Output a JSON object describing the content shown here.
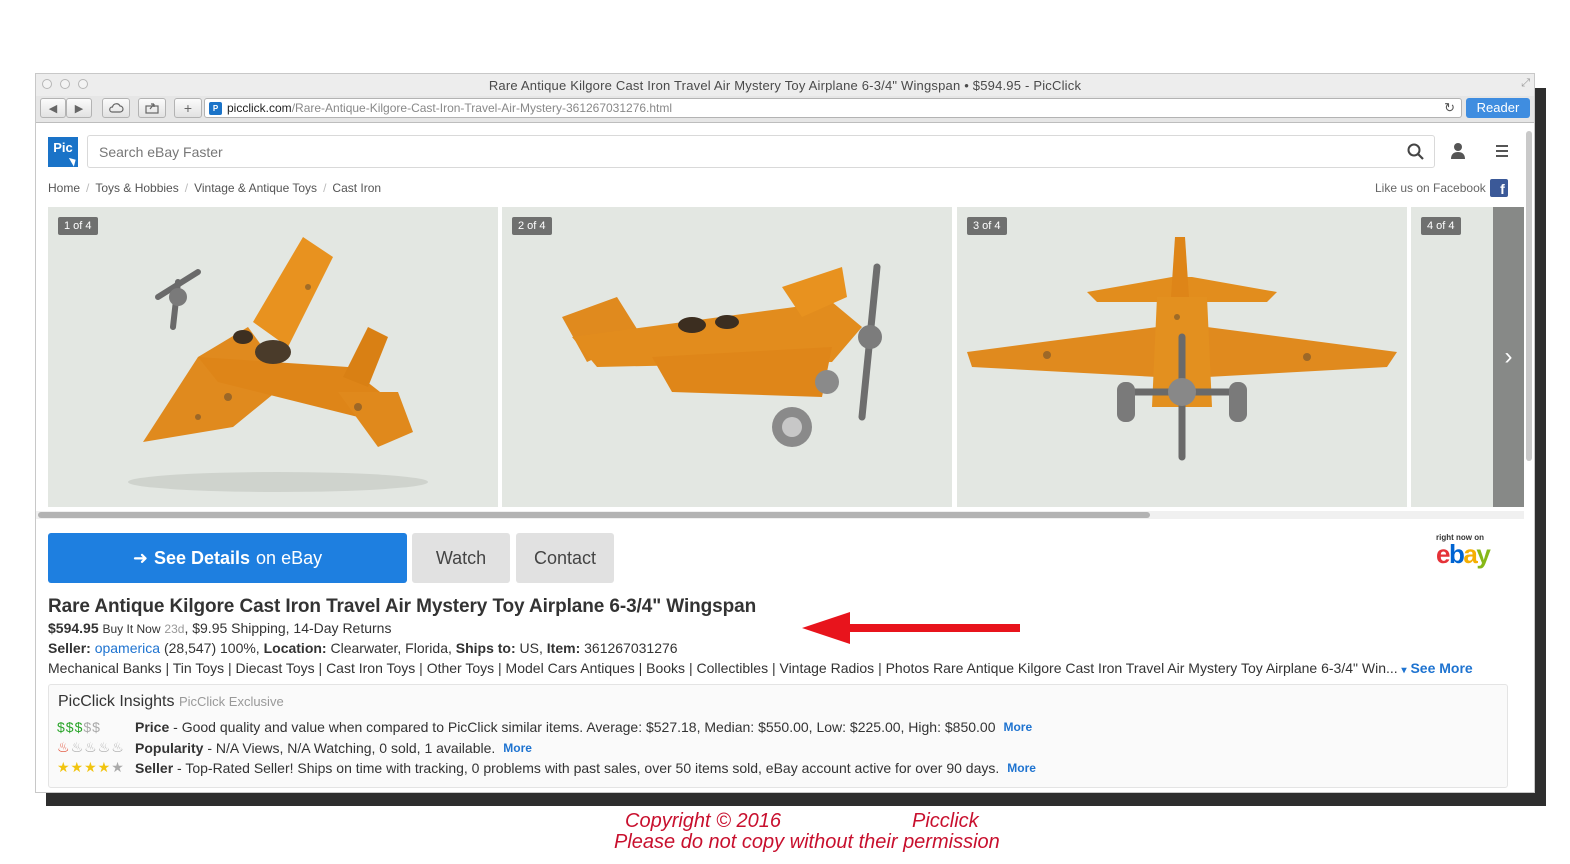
{
  "window": {
    "title": "Rare Antique Kilgore Cast Iron Travel Air Mystery Toy Airplane 6-3/4\" Wingspan • $594.95 - PicClick",
    "url_host": "picclick.com",
    "url_path": "/Rare-Antique-Kilgore-Cast-Iron-Travel-Air-Mystery-361267031276.html",
    "reader_label": "Reader"
  },
  "header": {
    "logo_text": "Pic",
    "search_placeholder": "Search eBay Faster"
  },
  "breadcrumb": [
    "Home",
    "Toys & Hobbies",
    "Vintage & Antique Toys",
    "Cast Iron"
  ],
  "facebook": {
    "label": "Like us on Facebook",
    "icon": "f"
  },
  "gallery": {
    "photos": [
      {
        "badge": "1 of 4"
      },
      {
        "badge": "2 of 4"
      },
      {
        "badge": "3 of 4"
      },
      {
        "badge": "4 of 4"
      }
    ],
    "next_icon": "›"
  },
  "actions": {
    "details_strong": "See Details",
    "details_rest": "on eBay",
    "watch": "Watch",
    "contact": "Contact",
    "ebay_tag": "right now on",
    "ebay_logo": [
      "e",
      "b",
      "a",
      "y"
    ]
  },
  "item": {
    "title": "Rare Antique Kilgore Cast Iron Travel Air Mystery Toy Airplane 6-3/4\" Wingspan",
    "price": "$594.95",
    "format": "Buy It Now",
    "age": "23d",
    "shipping": ", $9.95 Shipping, 14-Day Returns",
    "seller_label": "Seller:",
    "seller_name": "opamerica",
    "seller_feedback": "(28,547) 100%,",
    "location_label": "Location:",
    "location": "Clearwater, Florida,",
    "ships_label": "Ships to:",
    "ships_to": "US,",
    "item_label": "Item:",
    "item_number": "361267031276",
    "related": "Mechanical Banks | Tin Toys | Diecast Toys | Cast Iron Toys | Other Toys | Model Cars Antiques | Books | Collectibles | Vintage Radios | Photos Rare Antique Kilgore Cast Iron Travel Air Mystery Toy Airplane 6-3/4\" Win...",
    "see_more": "See More"
  },
  "insights": {
    "title": "PicClick Insights",
    "exclusive": "PicClick Exclusive",
    "rows": [
      {
        "rating_on": "$$$",
        "rating_off": "$$",
        "label": "Price",
        "text": "- Good quality and value when compared to PicClick similar items. Average: $527.18, Median: $550.00, Low: $225.00, High: $850.00",
        "more": "More"
      },
      {
        "rating_on": "♨",
        "rating_off": "♨♨♨♨",
        "label": "Popularity",
        "text": "- N/A Views, N/A Watching, 0 sold, 1 available.",
        "more": "More"
      },
      {
        "rating_on": "★★★★",
        "rating_off": "★",
        "label": "Seller",
        "text": "- Top-Rated Seller! Ships on time with tracking, 0 problems with past sales, over 50 items sold, eBay account active for over 90 days.",
        "more": "More"
      }
    ]
  },
  "watermark": {
    "copyright": "Copyright © 2016",
    "owner": "Picclick",
    "notice": "Please do not copy without their permission"
  },
  "colors": {
    "accent": "#1e7fe0",
    "link": "#1e73d0",
    "annotation_arrow": "#e8141c",
    "watermark": "#c8102e"
  }
}
